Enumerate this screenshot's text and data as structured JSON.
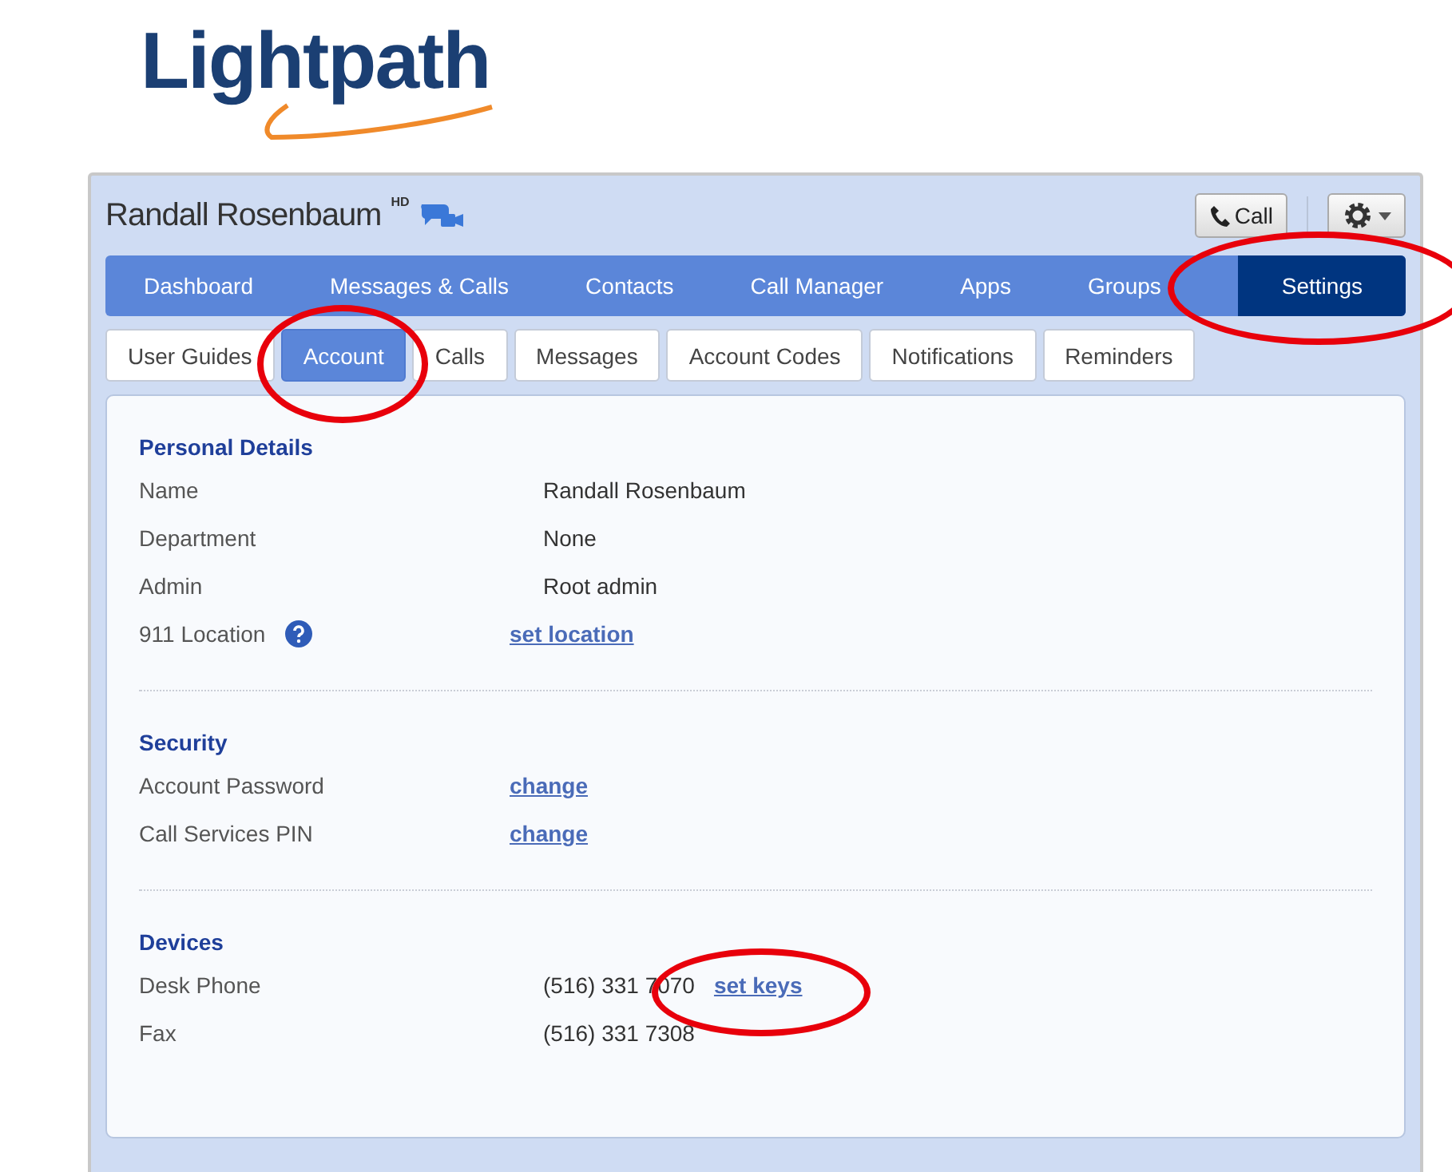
{
  "logo": {
    "text": "Lightpath"
  },
  "header": {
    "name": "Randall Rosenbaum",
    "badge": "HD",
    "call_button": "Call"
  },
  "nav": [
    {
      "label": "Dashboard",
      "selected": false,
      "circled": false
    },
    {
      "label": "Messages & Calls",
      "selected": false,
      "circled": false
    },
    {
      "label": "Contacts",
      "selected": false,
      "circled": false
    },
    {
      "label": "Call Manager",
      "selected": false,
      "circled": false
    },
    {
      "label": "Apps",
      "selected": false,
      "circled": false
    },
    {
      "label": "Groups",
      "selected": false,
      "circled": false
    },
    {
      "label": "Settings",
      "selected": true,
      "circled": true
    }
  ],
  "subtabs": [
    {
      "label": "User Guides",
      "selected": false,
      "circled": false
    },
    {
      "label": "Account",
      "selected": true,
      "circled": true
    },
    {
      "label": "Calls",
      "selected": false,
      "circled": false
    },
    {
      "label": "Messages",
      "selected": false,
      "circled": false
    },
    {
      "label": "Account Codes",
      "selected": false,
      "circled": false
    },
    {
      "label": "Notifications",
      "selected": false,
      "circled": false
    },
    {
      "label": "Reminders",
      "selected": false,
      "circled": false
    }
  ],
  "sections": [
    {
      "title": "Personal Details",
      "rows": [
        {
          "label": "Name",
          "kind": "text",
          "value": "Randall Rosenbaum",
          "help": false
        },
        {
          "label": "Department",
          "kind": "text",
          "value": "None",
          "help": false
        },
        {
          "label": "Admin",
          "kind": "text",
          "value": "Root admin",
          "help": false
        },
        {
          "label": "911 Location",
          "kind": "link",
          "value": "set location",
          "help": true
        }
      ]
    },
    {
      "title": "Security",
      "rows": [
        {
          "label": "Account Password",
          "kind": "link",
          "value": "change",
          "help": false
        },
        {
          "label": "Call Services PIN",
          "kind": "link",
          "value": "change",
          "help": false
        }
      ]
    },
    {
      "title": "Devices",
      "rows": [
        {
          "label": "Desk Phone",
          "kind": "text",
          "value": "(516) 331 7070",
          "help": false,
          "link": {
            "text": "set keys",
            "circled": true
          }
        },
        {
          "label": "Fax",
          "kind": "text",
          "value": "(516) 331 7308",
          "help": false
        }
      ]
    }
  ]
}
